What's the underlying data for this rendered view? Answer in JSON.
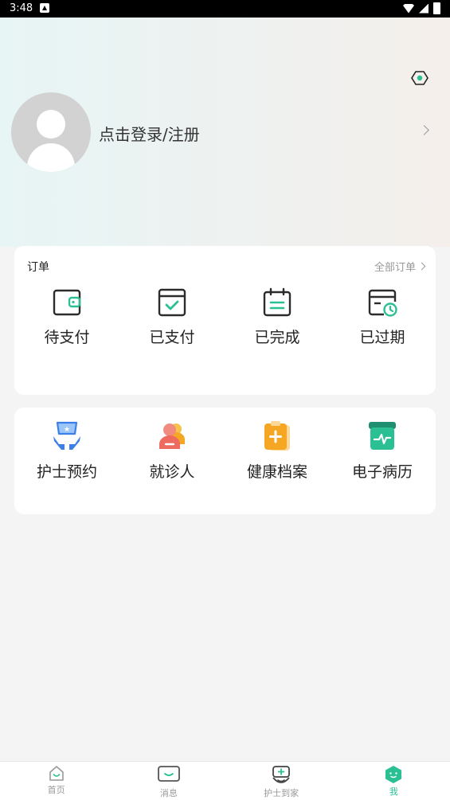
{
  "status_bar": {
    "time": "3:48"
  },
  "profile": {
    "login_text": "点击登录/注册"
  },
  "orders": {
    "title": "订单",
    "all_orders": "全部订单",
    "items": [
      {
        "label": "待支付",
        "icon": "wallet-icon"
      },
      {
        "label": "已支付",
        "icon": "paid-check-icon"
      },
      {
        "label": "已完成",
        "icon": "calendar-done-icon"
      },
      {
        "label": "已过期",
        "icon": "expired-clock-icon"
      }
    ]
  },
  "services": {
    "items": [
      {
        "label": "护士预约",
        "icon": "nurse-appointment-icon"
      },
      {
        "label": "就诊人",
        "icon": "patient-icon"
      },
      {
        "label": "健康档案",
        "icon": "health-record-icon"
      },
      {
        "label": "电子病历",
        "icon": "medical-record-icon"
      }
    ]
  },
  "tabbar": {
    "items": [
      {
        "label": "首页",
        "icon": "home-icon"
      },
      {
        "label": "消息",
        "icon": "message-icon"
      },
      {
        "label": "护士到家",
        "icon": "nurse-home-icon"
      },
      {
        "label": "我",
        "icon": "me-icon",
        "active": true
      }
    ]
  },
  "colors": {
    "accent": "#2bbf94",
    "orange": "#f5a623",
    "blue": "#3d7fe8",
    "red": "#ee6a5e"
  }
}
